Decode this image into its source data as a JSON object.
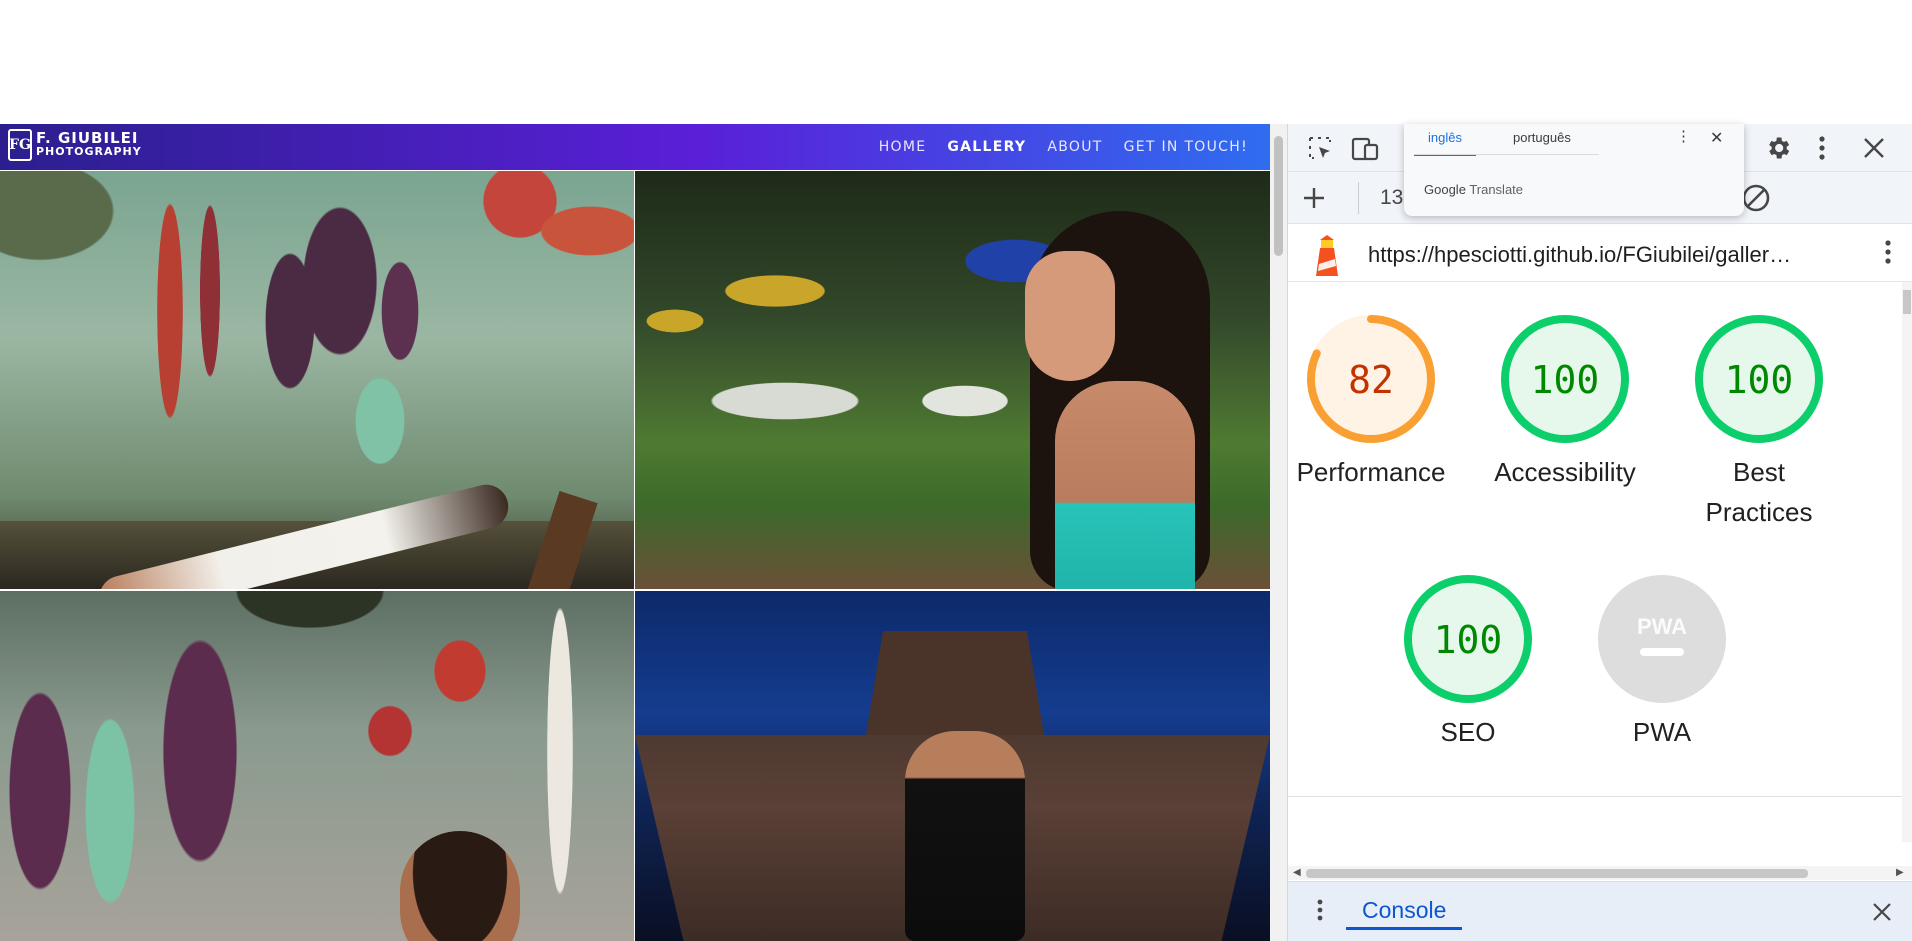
{
  "site": {
    "logo_line1": "F. GIUBILEI",
    "logo_line2": "PHOTOGRAPHY",
    "logo_mark": "FG",
    "nav": [
      {
        "label": "HOME",
        "active": false
      },
      {
        "label": "GALLERY",
        "active": true
      },
      {
        "label": "ABOUT",
        "active": false
      },
      {
        "label": "GET IN TOUCH!",
        "active": false
      }
    ]
  },
  "translate": {
    "tabs": [
      "inglês",
      "português"
    ],
    "active_tab": "inglês",
    "brand": "Google",
    "brand_suffix": "Translate"
  },
  "devtools": {
    "toolbar2_text": "13",
    "url": "https://hpesciotti.github.io/FGiubilei/galler…",
    "drawer_tab": "Console"
  },
  "lighthouse": {
    "scores": [
      {
        "label": "Performance",
        "score": "82",
        "value": 82,
        "color": "#fa9f32",
        "bg": "#fff3e6",
        "text": "#c33300"
      },
      {
        "label": "Accessibility",
        "score": "100",
        "value": 100,
        "color": "#0cce6b",
        "bg": "#e6f7ec",
        "text": "#008800"
      },
      {
        "label": "Best Practices",
        "score": "100",
        "value": 100,
        "color": "#0cce6b",
        "bg": "#e6f7ec",
        "text": "#008800"
      },
      {
        "label": "SEO",
        "score": "100",
        "value": 100,
        "color": "#0cce6b",
        "bg": "#e6f7ec",
        "text": "#008800"
      },
      {
        "label": "PWA",
        "score": "PWA",
        "value": null,
        "color": "#cccccc",
        "bg": "#dddddd",
        "text": "#999999"
      }
    ]
  },
  "icons": {
    "inspect": "inspect-element-icon",
    "device": "device-toolbar-icon",
    "settings": "gear-icon",
    "more": "more-vert-icon",
    "close": "close-icon",
    "add": "plus-icon",
    "clear": "block-icon"
  }
}
